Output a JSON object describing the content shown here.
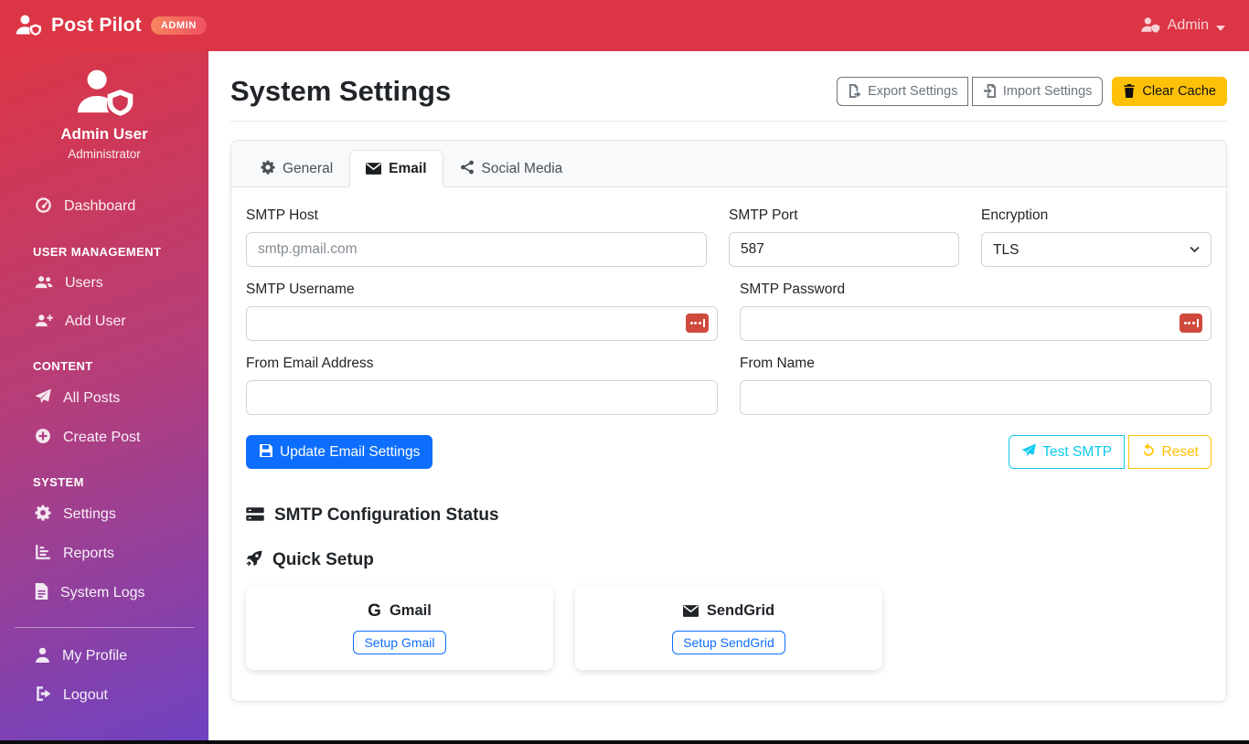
{
  "navbar": {
    "brand": "Post Pilot",
    "badge": "ADMIN",
    "user_menu": "Admin"
  },
  "sidebar": {
    "profile": {
      "name": "Admin User",
      "role": "Administrator"
    },
    "items": [
      {
        "type": "link",
        "label": "Dashboard",
        "icon": "dashboard-icon"
      },
      {
        "type": "header",
        "label": "USER MANAGEMENT"
      },
      {
        "type": "link",
        "label": "Users",
        "icon": "users-icon"
      },
      {
        "type": "link",
        "label": "Add User",
        "icon": "user-plus-icon"
      },
      {
        "type": "header",
        "label": "CONTENT"
      },
      {
        "type": "link",
        "label": "All Posts",
        "icon": "paper-plane-icon"
      },
      {
        "type": "link",
        "label": "Create Post",
        "icon": "plus-circle-icon"
      },
      {
        "type": "header",
        "label": "SYSTEM"
      },
      {
        "type": "link",
        "label": "Settings",
        "icon": "gear-icon"
      },
      {
        "type": "link",
        "label": "Reports",
        "icon": "chart-bars-icon"
      },
      {
        "type": "link",
        "label": "System Logs",
        "icon": "file-icon"
      },
      {
        "type": "divider",
        "label": ""
      },
      {
        "type": "link",
        "label": "My Profile",
        "icon": "user-icon"
      },
      {
        "type": "link",
        "label": "Logout",
        "icon": "logout-icon"
      }
    ]
  },
  "header": {
    "title": "System Settings",
    "export_label": "Export Settings",
    "import_label": "Import Settings",
    "clear_cache_label": "Clear Cache"
  },
  "tabs": [
    {
      "label": "General",
      "icon": "gear-icon",
      "active": false
    },
    {
      "label": "Email",
      "icon": "envelope-icon",
      "active": true
    },
    {
      "label": "Social Media",
      "icon": "share-icon",
      "active": false
    }
  ],
  "email_form": {
    "smtp_host": {
      "label": "SMTP Host",
      "placeholder": "smtp.gmail.com",
      "value": ""
    },
    "smtp_port": {
      "label": "SMTP Port",
      "value": "587"
    },
    "encryption": {
      "label": "Encryption",
      "selected": "TLS"
    },
    "smtp_username": {
      "label": "SMTP Username",
      "value": ""
    },
    "smtp_password": {
      "label": "SMTP Password",
      "value": ""
    },
    "from_email": {
      "label": "From Email Address",
      "value": ""
    },
    "from_name": {
      "label": "From Name",
      "value": ""
    },
    "update_button": "Update Email Settings",
    "test_button": "Test SMTP",
    "reset_button": "Reset"
  },
  "status_section": {
    "heading": "SMTP Configuration Status"
  },
  "quick_setup": {
    "heading": "Quick Setup",
    "providers": [
      {
        "name": "Gmail",
        "icon": "google-g-icon",
        "button": "Setup Gmail"
      },
      {
        "name": "SendGrid",
        "icon": "envelope-icon",
        "button": "Setup SendGrid"
      }
    ]
  },
  "icons": {
    "user-shield-icon": "person with shield shape",
    "caret-down-icon": "▾",
    "gear-icon": "⚙",
    "envelope-icon": "✉",
    "share-icon": "connected dots",
    "trash-icon": "trash can",
    "save-icon": "floppy disk",
    "paper-plane-icon": "paper plane",
    "undo-icon": "↺",
    "server-icon": "stacked server bars",
    "rocket-icon": "rocket",
    "password-manager-icon": "red square with dots"
  },
  "colors": {
    "navbar": "#dc3545",
    "sidebar_gradient_end": "#6f42c1",
    "primary": "#0d6efd",
    "warning": "#ffc107",
    "info": "#0dcaf0",
    "badge_gradient": "#f8855e → #ef5063"
  }
}
